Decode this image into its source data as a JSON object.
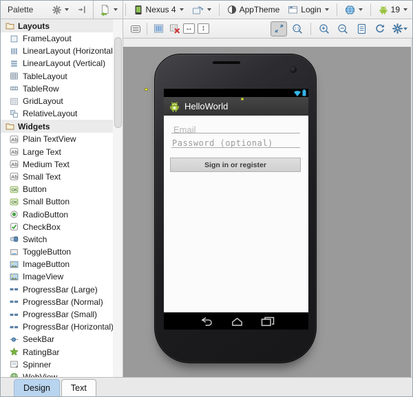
{
  "palette": {
    "title": "Palette",
    "sections": [
      {
        "label": "Layouts",
        "items": [
          {
            "label": "FrameLayout",
            "icon": "frame"
          },
          {
            "label": "LinearLayout (Horizontal)",
            "icon": "linear_h"
          },
          {
            "label": "LinearLayout (Vertical)",
            "icon": "linear_v"
          },
          {
            "label": "TableLayout",
            "icon": "table"
          },
          {
            "label": "TableRow",
            "icon": "table_row"
          },
          {
            "label": "GridLayout",
            "icon": "grid"
          },
          {
            "label": "RelativeLayout",
            "icon": "relative"
          }
        ]
      },
      {
        "label": "Widgets",
        "items": [
          {
            "label": "Plain TextView",
            "icon": "ab"
          },
          {
            "label": "Large Text",
            "icon": "ab"
          },
          {
            "label": "Medium Text",
            "icon": "ab"
          },
          {
            "label": "Small Text",
            "icon": "ab"
          },
          {
            "label": "Button",
            "icon": "ok"
          },
          {
            "label": "Small Button",
            "icon": "ok"
          },
          {
            "label": "RadioButton",
            "icon": "radio"
          },
          {
            "label": "CheckBox",
            "icon": "check"
          },
          {
            "label": "Switch",
            "icon": "switch"
          },
          {
            "label": "ToggleButton",
            "icon": "toggle"
          },
          {
            "label": "ImageButton",
            "icon": "image"
          },
          {
            "label": "ImageView",
            "icon": "image"
          },
          {
            "label": "ProgressBar (Large)",
            "icon": "progress"
          },
          {
            "label": "ProgressBar (Normal)",
            "icon": "progress"
          },
          {
            "label": "ProgressBar (Small)",
            "icon": "progress"
          },
          {
            "label": "ProgressBar (Horizontal)",
            "icon": "progress"
          },
          {
            "label": "SeekBar",
            "icon": "seek"
          },
          {
            "label": "RatingBar",
            "icon": "rating"
          },
          {
            "label": "Spinner",
            "icon": "spinner"
          },
          {
            "label": "WebView",
            "icon": "web"
          }
        ]
      }
    ]
  },
  "toolbar_top": {
    "device": "Nexus 4",
    "theme": "AppTheme",
    "activity": "Login",
    "api_level": "19"
  },
  "icons": {
    "width_arrow": "↔",
    "height_arrow": "↕"
  },
  "preview": {
    "app_title": "HelloWorld",
    "email_placeholder": "Email",
    "password_placeholder": "Password (optional)",
    "signin_label": "Sign in or register"
  },
  "tabs": {
    "design": "Design",
    "text": "Text"
  },
  "colors": {
    "accent_teal": "#33b5e5",
    "android_green": "#9fc33c",
    "canvas_gray": "#9a9a9a",
    "tab_selected_blue": "#b9d4ee",
    "lint_yellow": "#e9ef3b"
  }
}
